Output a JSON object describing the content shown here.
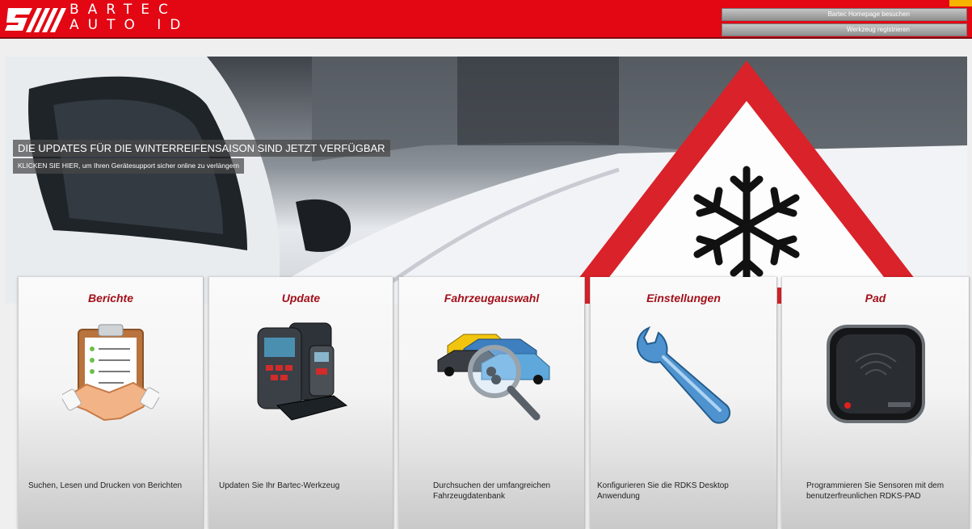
{
  "header": {
    "logo_line1": "BARTEC",
    "logo_line2": "AUTO ID",
    "links": [
      "Bartec Homepage besuchen",
      "Werkzeug registrieren"
    ]
  },
  "banner": {
    "title": "DIE UPDATES FÜR DIE WINTERREIFENSAISON SIND JETZT VERFÜGBAR",
    "subtitle": "KLICKEN SIE HIER, um Ihren Gerätesupport sicher online zu verlängern"
  },
  "cards": [
    {
      "title": "Berichte",
      "description": "Suchen, Lesen und Drucken von Berichten",
      "icon": "clipboard-handshake-icon"
    },
    {
      "title": "Update",
      "description": "Updaten Sie Ihr Bartec-Werkzeug",
      "icon": "tpms-tools-icon"
    },
    {
      "title": "Fahrzeugauswahl",
      "description": "Durchsuchen der umfangreichen Fahrzeugdatenbank",
      "icon": "cars-magnifier-icon"
    },
    {
      "title": "Einstellungen",
      "description": "Konfigurieren Sie die RDKS Desktop Anwendung",
      "icon": "wrench-icon"
    },
    {
      "title": "Pad",
      "description": "Programmieren Sie Sensoren mit dem benutzerfreunlichen RDKS-PAD",
      "icon": "rdks-pad-icon"
    }
  ],
  "colors": {
    "brand_red": "#e30613",
    "title_red": "#a3101a",
    "accent_yellow": "#f6b400"
  }
}
